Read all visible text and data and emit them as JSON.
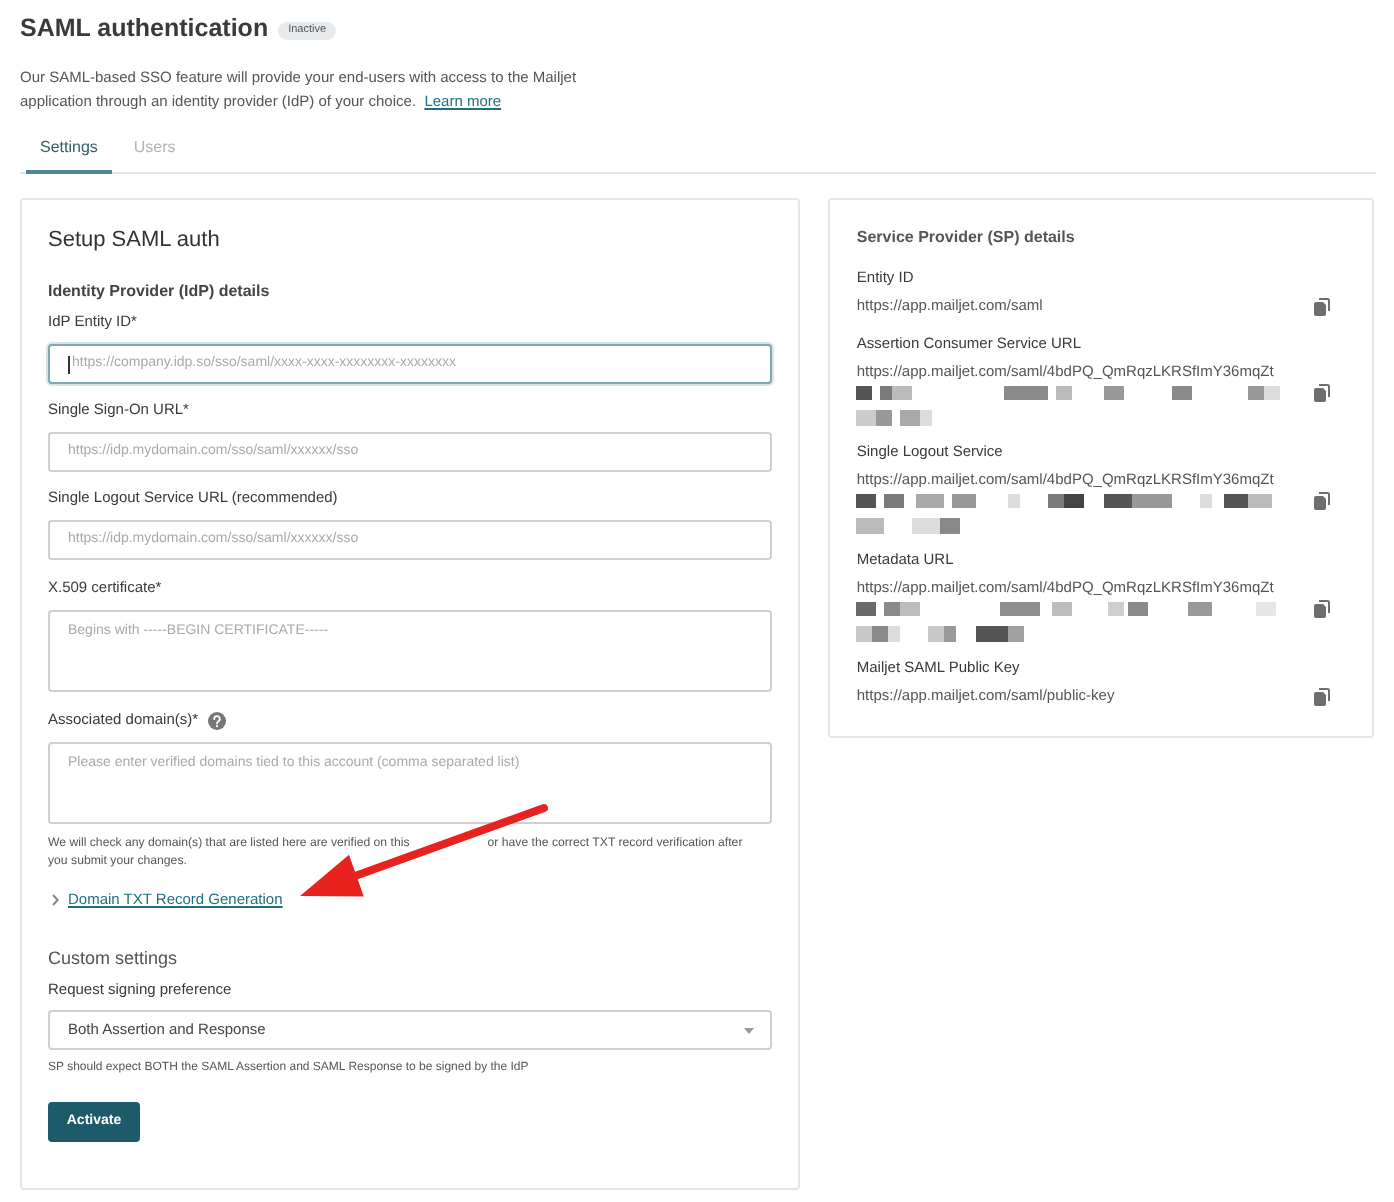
{
  "header": {
    "title": "SAML authentication",
    "status_badge": "Inactive"
  },
  "description": {
    "text": "Our SAML-based SSO feature will provide your end-users with access to the Mailjet application through an identity provider (IdP) of your choice.",
    "link": "Learn more"
  },
  "tabs": [
    {
      "label": "Settings",
      "selected": true
    },
    {
      "label": "Users",
      "selected": false
    }
  ],
  "setup_card": {
    "title": "Setup SAML auth",
    "section": "Identity Provider (IdP) details",
    "fields": [
      {
        "kind": "input",
        "label": "IdP Entity ID*",
        "placeholder": "https://company.idp.so/sso/saml/xxxx-xxxx-xxxxxxxx-xxxxxxxx",
        "focused": true,
        "help_icon": false
      },
      {
        "kind": "input",
        "label": "Single Sign-On URL*",
        "placeholder": "https://idp.mydomain.com/sso/saml/xxxxxx/sso",
        "focused": false,
        "help_icon": false
      },
      {
        "kind": "input",
        "label": "Single Logout Service URL (recommended)",
        "placeholder": "https://idp.mydomain.com/sso/saml/xxxxxx/sso",
        "focused": false,
        "help_icon": false
      },
      {
        "kind": "textarea",
        "label": "X.509 certificate*",
        "placeholder": "Begins with -----BEGIN CERTIFICATE-----",
        "focused": false,
        "help_icon": false
      },
      {
        "kind": "textarea",
        "label": "Associated domain(s)*",
        "placeholder": "Please enter verified domains tied to this account (comma separated list)",
        "focused": false,
        "help_icon": true,
        "hint_lines": [
          [
            "We will check any domain(s) that are listed here are verified on this",
            "or have the correct TXT record verification after"
          ],
          [
            "you submit your changes."
          ]
        ]
      }
    ],
    "expander": {
      "label": "Domain TXT Record Generation",
      "expanded": false
    },
    "custom_section": "Custom settings",
    "select": {
      "label": "Request signing preference",
      "value": "Both Assertion and Response",
      "hint": "SP should expect BOTH the SAML Assertion and SAML Response to be signed by the IdP"
    },
    "button": "Activate"
  },
  "sp_card": {
    "title": "Service Provider (SP) details",
    "items": [
      {
        "label": "Entity ID",
        "value": "https://app.mailjet.com/saml",
        "redacted": false
      },
      {
        "label": "Assertion Consumer Service URL",
        "value": "https://app.mailjet.com/saml/4bdPQ_QmRqzLKRSfImY36mqZt",
        "redacted": true
      },
      {
        "label": "Single Logout Service",
        "value": "https://app.mailjet.com/saml/4bdPQ_QmRqzLKRSfImY36mqZt",
        "redacted": true
      },
      {
        "label": "Metadata URL",
        "value": "https://app.mailjet.com/saml/4bdPQ_QmRqzLKRSfImY36mqZt",
        "redacted": true
      },
      {
        "label": "Mailjet SAML Public Key",
        "value": "https://app.mailjet.com/saml/public-key",
        "redacted": false
      }
    ]
  },
  "annotation_arrow": true
}
